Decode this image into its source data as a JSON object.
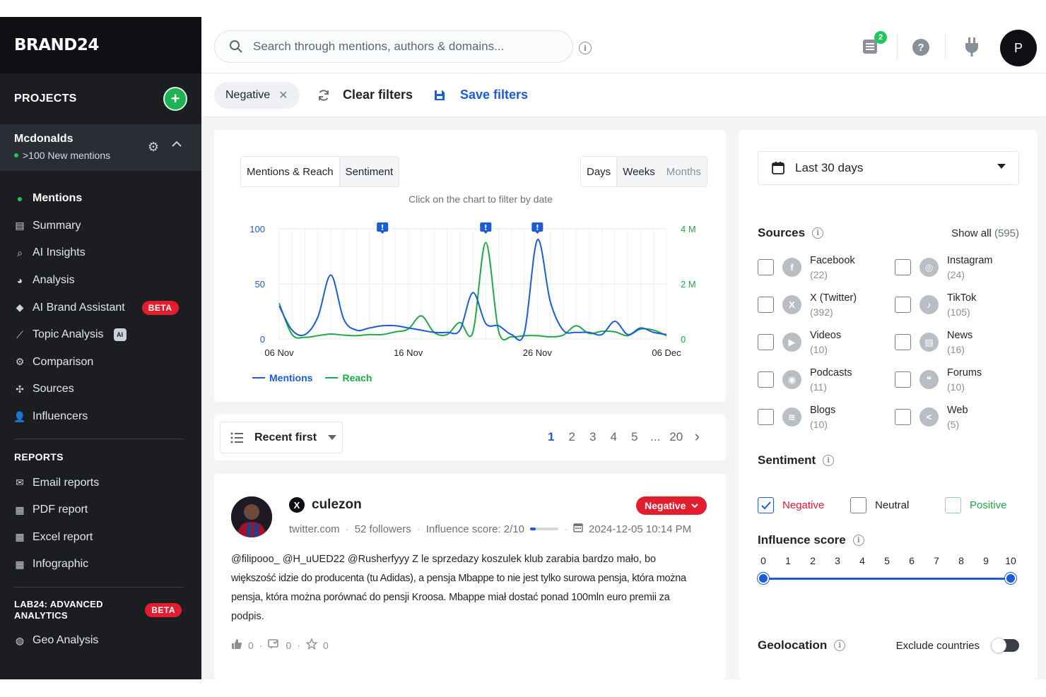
{
  "brand": "BRAND24",
  "sidebar": {
    "projects_label": "PROJECTS",
    "project": {
      "name": "Mcdonalds",
      "status": ">100 New mentions"
    },
    "nav": [
      {
        "label": "Mentions",
        "icon": "chat-bubble-icon",
        "active": true
      },
      {
        "label": "Summary",
        "icon": "document-icon"
      },
      {
        "label": "AI Insights",
        "icon": "magnifier-icon"
      },
      {
        "label": "Analysis",
        "icon": "pie-chart-icon"
      },
      {
        "label": "AI Brand Assistant",
        "icon": "assistant-chat-icon",
        "badge": "BETA"
      },
      {
        "label": "Topic Analysis",
        "icon": "line-chart-icon",
        "badge_ai": "AI"
      },
      {
        "label": "Comparison",
        "icon": "cog-compare-icon"
      },
      {
        "label": "Sources",
        "icon": "sources-icon"
      },
      {
        "label": "Influencers",
        "icon": "person-icon"
      }
    ],
    "reports_label": "REPORTS",
    "reports": [
      {
        "label": "Email reports",
        "icon": "envelope-icon"
      },
      {
        "label": "PDF report",
        "icon": "pdf-file-icon"
      },
      {
        "label": "Excel report",
        "icon": "excel-file-icon"
      },
      {
        "label": "Infographic",
        "icon": "infographic-file-icon"
      }
    ],
    "lab_label_1": "LAB24: ADVANCED",
    "lab_label_2": "ANALYTICS",
    "lab_badge": "BETA",
    "lab_items": [
      {
        "label": "Geo Analysis",
        "icon": "globe-icon"
      }
    ]
  },
  "topbar": {
    "search_placeholder": "Search through mentions, authors & domains...",
    "notif_count": "2",
    "help_glyph": "?",
    "avatar_initial": "P"
  },
  "filters": {
    "active_chip": "Negative",
    "clear_label": "Clear filters",
    "save_label": "Save filters"
  },
  "chart": {
    "tabs": [
      "Mentions & Reach",
      "Sentiment"
    ],
    "periods": [
      "Days",
      "Weeks",
      "Months"
    ],
    "hint": "Click on the chart to filter by date",
    "legend": [
      "Mentions",
      "Reach"
    ],
    "colors": {
      "mentions": "#1b5cd9",
      "reach": "#1faa43"
    }
  },
  "chart_data": {
    "type": "line",
    "x_ticks": [
      "06 Nov",
      "16 Nov",
      "26 Nov",
      "06 Dec"
    ],
    "left_axis": {
      "ticks": [
        "100",
        "50",
        "0"
      ],
      "range": [
        0,
        100
      ]
    },
    "right_axis": {
      "ticks": [
        "4 M",
        "2 M",
        "0"
      ],
      "range": [
        0,
        4000000
      ]
    },
    "x": [
      "2024-11-06",
      "2024-11-07",
      "2024-11-08",
      "2024-11-09",
      "2024-11-10",
      "2024-11-11",
      "2024-11-12",
      "2024-11-13",
      "2024-11-14",
      "2024-11-15",
      "2024-11-16",
      "2024-11-17",
      "2024-11-18",
      "2024-11-19",
      "2024-11-20",
      "2024-11-21",
      "2024-11-22",
      "2024-11-23",
      "2024-11-24",
      "2024-11-25",
      "2024-11-26",
      "2024-11-27",
      "2024-11-28",
      "2024-11-29",
      "2024-11-30",
      "2024-12-01",
      "2024-12-02",
      "2024-12-03",
      "2024-12-04",
      "2024-12-05",
      "2024-12-06"
    ],
    "series": [
      {
        "name": "Mentions",
        "axis": "left",
        "values": [
          30,
          8,
          4,
          20,
          58,
          18,
          8,
          10,
          12,
          12,
          10,
          8,
          6,
          6,
          8,
          42,
          14,
          12,
          4,
          6,
          90,
          34,
          8,
          6,
          6,
          4,
          16,
          4,
          10,
          6,
          4
        ]
      },
      {
        "name": "Reach",
        "axis": "right",
        "values": [
          1300000,
          160000,
          60000,
          120000,
          180000,
          140000,
          120000,
          160000,
          160000,
          260000,
          360000,
          840000,
          240000,
          160000,
          600000,
          240000,
          3500000,
          280000,
          80000,
          120000,
          120000,
          80000,
          140000,
          480000,
          200000,
          280000,
          260000,
          120000,
          360000,
          320000,
          120000
        ]
      }
    ],
    "alert_markers": [
      "2024-11-14",
      "2024-11-22",
      "2024-11-26"
    ]
  },
  "list": {
    "sort_label": "Recent first",
    "pages": [
      "1",
      "2",
      "3",
      "4",
      "5",
      "...",
      "20"
    ],
    "current_page": "1"
  },
  "post": {
    "author": "culezon",
    "sentiment": "Negative",
    "domain": "twitter.com",
    "followers": "52 followers",
    "influence": "Influence score: 2/10",
    "influence_value": 0.2,
    "date": "2024-12-05 10:14 PM",
    "lines": [
      "@filipooo_ @H_uUED22 @Rusherfyyy Z le sprzedazy koszulek klub zarabia bardzo mało, bo",
      "większość idzie do producenta (tu Adidas), a pensja Mbappe to nie jest tylko surowa pensja, która można",
      "pensja, która można porównać do pensji  Kroosa. Mbappe miał dostać ponad 100mln euro premii za",
      "podpis."
    ],
    "likes": "0",
    "shares": "0",
    "stars": "0"
  },
  "right_panel": {
    "date_range": "Last 30 days",
    "sources_label": "Sources",
    "show_all": "Show all",
    "show_all_count": "(595)",
    "sources": [
      {
        "name": "Facebook",
        "count": "(22)",
        "icon": "facebook-icon",
        "glyph": "f"
      },
      {
        "name": "Instagram",
        "count": "(24)",
        "icon": "instagram-icon",
        "glyph": "◎"
      },
      {
        "name": "X (Twitter)",
        "count": "(392)",
        "icon": "x-twitter-icon",
        "glyph": "X"
      },
      {
        "name": "TikTok",
        "count": "(105)",
        "icon": "tiktok-icon",
        "glyph": "♪"
      },
      {
        "name": "Videos",
        "count": "(10)",
        "icon": "play-icon",
        "glyph": "▶"
      },
      {
        "name": "News",
        "count": "(16)",
        "icon": "newspaper-icon",
        "glyph": "▤"
      },
      {
        "name": "Podcasts",
        "count": "(11)",
        "icon": "podcast-icon",
        "glyph": "◉"
      },
      {
        "name": "Forums",
        "count": "(10)",
        "icon": "forum-icon",
        "glyph": "❝"
      },
      {
        "name": "Blogs",
        "count": "(10)",
        "icon": "rss-icon",
        "glyph": "≋"
      },
      {
        "name": "Web",
        "count": "(5)",
        "icon": "share-icon",
        "glyph": "<"
      }
    ],
    "sentiment_label": "Sentiment",
    "sentiments": [
      {
        "label": "Negative",
        "checked": true,
        "color": "#e11d2e"
      },
      {
        "label": "Neutral",
        "checked": false,
        "color": "#1f2328"
      },
      {
        "label": "Positive",
        "checked": false,
        "color": "#1faa43"
      }
    ],
    "influence_label": "Influence score",
    "influence_ticks": [
      "0",
      "1",
      "2",
      "3",
      "4",
      "5",
      "6",
      "7",
      "8",
      "9",
      "10"
    ],
    "influence_range": [
      0,
      10
    ],
    "geo_label": "Geolocation",
    "exclude_label": "Exclude countries"
  }
}
